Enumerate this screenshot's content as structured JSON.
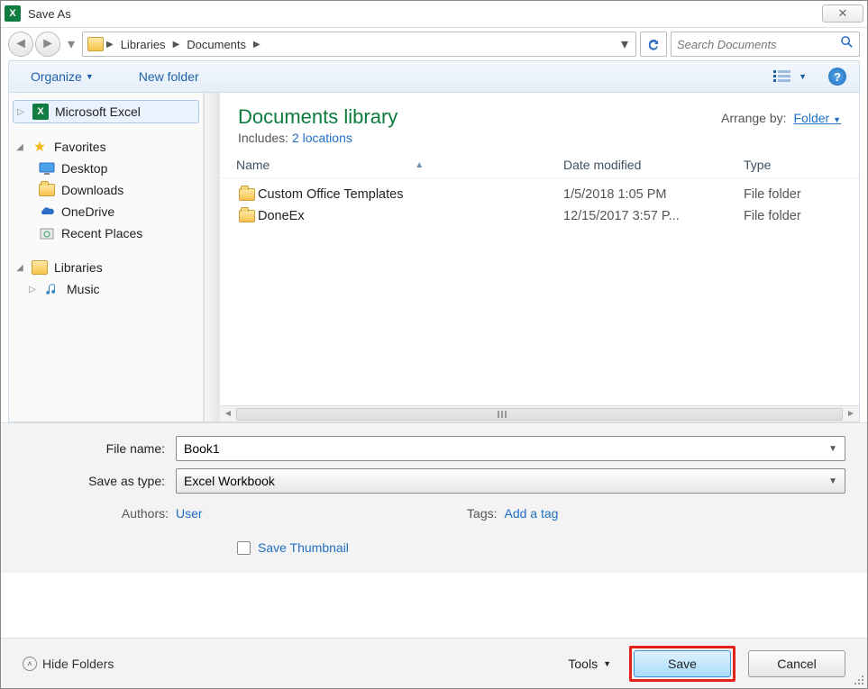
{
  "title": "Save As",
  "breadcrumb": {
    "item1": "Libraries",
    "item2": "Documents"
  },
  "search": {
    "placeholder": "Search Documents"
  },
  "toolbar": {
    "organize": "Organize",
    "newfolder": "New folder"
  },
  "sidebar": {
    "excel": "Microsoft Excel",
    "favorites": "Favorites",
    "desktop": "Desktop",
    "downloads": "Downloads",
    "onedrive": "OneDrive",
    "recent": "Recent Places",
    "libraries": "Libraries",
    "music": "Music"
  },
  "library": {
    "title": "Documents library",
    "includes_label": "Includes:",
    "locations": "2 locations",
    "arrange_label": "Arrange by:",
    "arrange_value": "Folder"
  },
  "columns": {
    "name": "Name",
    "date": "Date modified",
    "type": "Type"
  },
  "rows": [
    {
      "name": "Custom Office Templates",
      "date": "1/5/2018 1:05 PM",
      "type": "File folder"
    },
    {
      "name": "DoneEx",
      "date": "12/15/2017 3:57 P...",
      "type": "File folder"
    }
  ],
  "form": {
    "filename_label": "File name:",
    "filename_value": "Book1",
    "type_label": "Save as type:",
    "type_value": "Excel Workbook",
    "authors_label": "Authors:",
    "authors_value": "User",
    "tags_label": "Tags:",
    "tags_value": "Add a tag",
    "thumbnail": "Save Thumbnail"
  },
  "footer": {
    "hide": "Hide Folders",
    "tools": "Tools",
    "save": "Save",
    "cancel": "Cancel"
  }
}
